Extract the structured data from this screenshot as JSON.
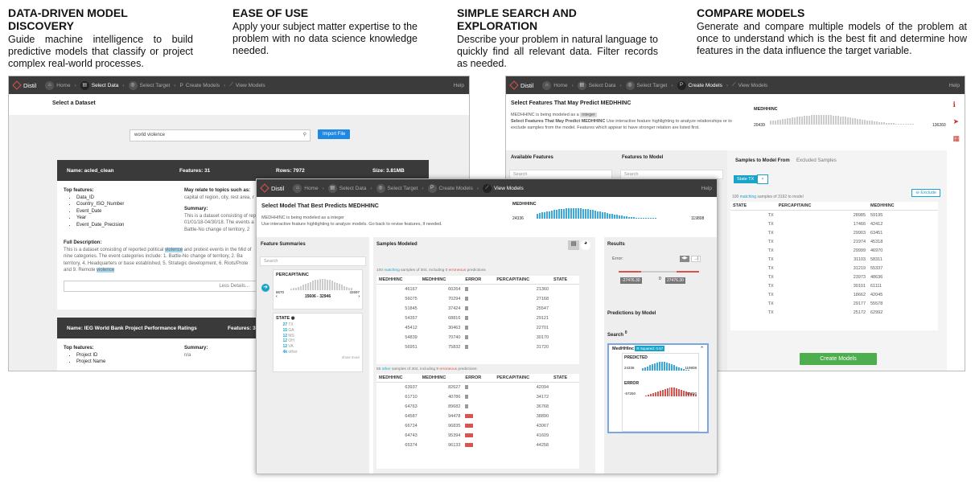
{
  "features": [
    {
      "title": "DATA-DRIVEN MODEL DISCOVERY",
      "text": "Guide machine intelligence to build predictive models that classify or project complex real-world processes."
    },
    {
      "title": "EASE OF USE",
      "text": "Apply your subject matter expertise to the problem with no data science knowledge needed."
    },
    {
      "title": "SIMPLE SEARCH AND EXPLORATION",
      "text": "Describe your problem in natural language to quickly find all relevant data. Filter records as needed."
    },
    {
      "title": "COMPARE MODELS",
      "text": "Generate and compare multiple models of the problem at once to understand which is the best fit and determine how features in the data influence the target variable."
    }
  ],
  "nav": {
    "brand": "Distil",
    "home": "Home",
    "select_data": "Select Data",
    "select_target": "Select Target",
    "create_models": "Create Models",
    "view_models": "View Models",
    "help": "Help"
  },
  "shot1": {
    "heading": "Select a Dataset",
    "search_value": "world violence",
    "import_label": "Import File",
    "card1": {
      "name": "Name: acled_clean",
      "features": "Features: 31",
      "rows": "Rows: 7972",
      "size": "Size: 3.81MB"
    },
    "top_features_label": "Top features:",
    "top_features": [
      "Data_ID",
      "Country_ISO_Number",
      "Event_Date",
      "Year",
      "Event_Date_Precision"
    ],
    "may_relate": "May relate to topics such as:",
    "topics": "capital of region, city, rest area, r",
    "summary_label": "Summary:",
    "summary_text": "This is a dataset consisting of rep 01/01/18-04/30/18. The events a 1. Battle-No change of territory, 2",
    "full_desc_label": "Full Description:",
    "full_desc_1": "This is a dataset consisting of reported political ",
    "full_desc_hl1": "violence",
    "full_desc_2": " and protest events in the Mid of nine categories. The event categories include: 1. Battle-No change of territory, 2. Ba territory, 4. Headquarters or base established, 5. Strategic development, 6. Riots/Prote and 9. Remote ",
    "full_desc_hl2": "violence",
    "less_details": "Less Details...",
    "card2": {
      "name": "Name: IEG World Bank Project Performance Ratings",
      "features": "Features: 3"
    },
    "top_features2": [
      "Project ID",
      "Project Name"
    ],
    "summary2": "n/a"
  },
  "shot2": {
    "heading": "Select Model That Best Predicts MEDHHINC",
    "sub1": "MEDHHINC is being modeled as a integer",
    "sub2": "Use interactive feature highlighting to analyze models. Go back to revise features, if needed.",
    "target_label": "MEDHHINC",
    "hist_min": "24336",
    "hist_max": "119808",
    "feature_summaries": "Feature Summaries",
    "search_ph": "Search",
    "percap": "PERCAPITAINC",
    "percap_min": "8670",
    "percap_max": "32697",
    "percap_range": "15606 - 32946",
    "state": "STATE",
    "states": [
      {
        "n": "27",
        "s": "TX"
      },
      {
        "n": "15",
        "s": "GA"
      },
      {
        "n": "12",
        "s": "MS"
      },
      {
        "n": "12",
        "s": "OH"
      },
      {
        "n": "12",
        "s": "VA"
      },
      {
        "n": "4k",
        "s": "other"
      }
    ],
    "show_more": "show more",
    "samples_modeled": "Samples Modeled",
    "matching_note_a": "100 ",
    "matching_word": "matching",
    "matching_note_b": " samples of 304, including 0 ",
    "erroneous_word": "erroneous",
    "matching_note_c": " predictions",
    "cols": [
      "MEDHHINC",
      "MEDHHINC",
      "ERROR",
      "PERCAPITAINC",
      "STATE"
    ],
    "rows1": [
      [
        "46167",
        "60264",
        "",
        "21360",
        ""
      ],
      [
        "56075",
        "70294",
        "",
        "27168",
        ""
      ],
      [
        "51845",
        "37424",
        "",
        "25547",
        ""
      ],
      [
        "54357",
        "68816",
        "",
        "29121",
        ""
      ],
      [
        "45412",
        "30463",
        "",
        "22701",
        ""
      ],
      [
        "54839",
        "70740",
        "",
        "30170",
        ""
      ],
      [
        "56951",
        "75832",
        "",
        "31720",
        ""
      ]
    ],
    "other_note_a": "65 ",
    "other_word": "other",
    "other_note_b": " samples of 304, including 9 ",
    "other_note_c": " predictions",
    "rows2": [
      [
        "63937",
        "82627",
        "",
        "42094",
        ""
      ],
      [
        "61710",
        "40786",
        "",
        "34172",
        ""
      ],
      [
        "64763",
        "89682",
        "",
        "36768",
        ""
      ],
      [
        "64587",
        "94478",
        "",
        "38890",
        ""
      ],
      [
        "66724",
        "96835",
        "",
        "43067",
        ""
      ],
      [
        "64743",
        "95394",
        "",
        "41609",
        ""
      ],
      [
        "65374",
        "96133",
        "",
        "44258",
        ""
      ]
    ],
    "results": "Results",
    "error_label": "Error:",
    "err_neg": "-27476.30",
    "err_zero": "0",
    "err_pos": "27476.30",
    "predictions_by_model": "Predictions by Model",
    "search_count": "Search",
    "model_name": "MedHHInc",
    "r2_badge": "R Squared: 0.57",
    "predicted": "PREDICTED",
    "pred_min": "24336",
    "pred_max": "119808",
    "error": "ERROR",
    "errh_min": "-57250",
    "errh_max": "57250"
  },
  "shot3": {
    "heading": "Select Features That May Predict MEDHHINC",
    "modeled_as": "MEDHHINC is being modeled as a",
    "type_badge": "integer",
    "desc_bold": "Select Features That May Predict MEDHHINC",
    "desc": "Use interactive feature highlighting to analyze relationships or to exclude samples from the model. Features which appear to have stronger relation are listed first.",
    "target_label": "MEDHHINC",
    "h_min": "20439",
    "h_max": "136260",
    "available": "Available Features",
    "to_model": "Features to Model",
    "search_ph": "Search",
    "samples_from": "Samples to Model From",
    "excluded": "Excluded Samples",
    "filter_chip": "State TX",
    "exclude_btn": "Exclude",
    "note_a": "100 ",
    "note_match": "matching",
    "note_b": " samples of 3192 to model",
    "cols": [
      "STATE",
      "PERCAPITAINC",
      "MEDHHINC"
    ],
    "rows": [
      [
        "TX",
        "28985",
        "59195"
      ],
      [
        "TX",
        "17466",
        "42412"
      ],
      [
        "TX",
        "29903",
        "63451"
      ],
      [
        "TX",
        "21974",
        "45318"
      ],
      [
        "TX",
        "29999",
        "46970"
      ],
      [
        "TX",
        "31103",
        "58311"
      ],
      [
        "TX",
        "31219",
        "55337"
      ],
      [
        "TX",
        "23973",
        "48636"
      ],
      [
        "TX",
        "30101",
        "61111"
      ],
      [
        "TX",
        "18662",
        "42045"
      ],
      [
        "TX",
        "29177",
        "55578"
      ],
      [
        "TX",
        "25172",
        "62992"
      ]
    ],
    "create_models": "Create Models"
  },
  "colors": {
    "accent": "#1e88e5",
    "nav": "#3b3b3b",
    "teal": "#1aa3c9",
    "green": "#4cae4c",
    "red": "#d9534f"
  }
}
